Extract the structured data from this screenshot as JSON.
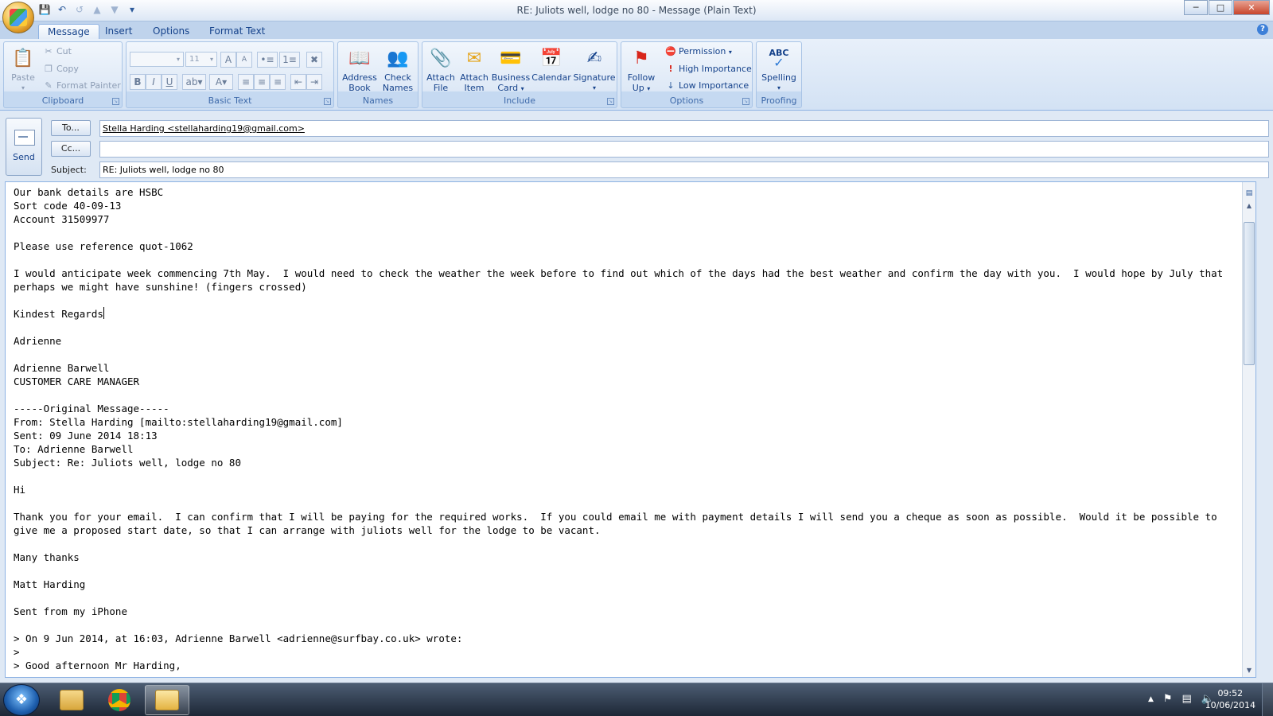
{
  "window": {
    "title": "RE: Juliots well, lodge no 80 - Message (Plain Text)"
  },
  "qat": {
    "save_icon": "save-icon",
    "undo_icon": "undo-icon",
    "redo_icon": "redo-icon"
  },
  "tabs": [
    {
      "label": "Message",
      "active": true
    },
    {
      "label": "Insert"
    },
    {
      "label": "Options"
    },
    {
      "label": "Format Text"
    }
  ],
  "ribbon": {
    "clipboard": {
      "label": "Clipboard",
      "paste": "Paste",
      "cut": "Cut",
      "copy": "Copy",
      "format_painter": "Format Painter"
    },
    "basic_text": {
      "label": "Basic Text",
      "font_size": "11",
      "bold": "B",
      "italic": "I",
      "underline": "U"
    },
    "names": {
      "label": "Names",
      "address_book_1": "Address",
      "address_book_2": "Book",
      "check_names_1": "Check",
      "check_names_2": "Names"
    },
    "include": {
      "label": "Include",
      "attach_file_1": "Attach",
      "attach_file_2": "File",
      "attach_item_1": "Attach",
      "attach_item_2": "Item",
      "business_card_1": "Business",
      "business_card_2": "Card",
      "calendar": "Calendar",
      "signature": "Signature"
    },
    "options": {
      "label": "Options",
      "follow_up_1": "Follow",
      "follow_up_2": "Up",
      "permission": "Permission",
      "high_importance": "High Importance",
      "low_importance": "Low Importance"
    },
    "proofing": {
      "label": "Proofing",
      "spelling": "Spelling",
      "abc": "ABC"
    }
  },
  "header": {
    "send_label": "Send",
    "to_label": "To...",
    "cc_label": "Cc...",
    "subject_label": "Subject:",
    "to_value": "Stella Harding <stellaharding19@gmail.com>",
    "cc_value": "",
    "subject_value": "RE: Juliots well, lodge no 80"
  },
  "body": {
    "before_caret": "Our bank details are HSBC\nSort code 40-09-13\nAccount 31509977\n\nPlease use reference quot-1062\n\nI would anticipate week commencing 7th May.  I would need to check the weather the week before to find out which of the days had the best weather and confirm the day with you.  I would hope by July that perhaps we might have sunshine! (fingers crossed)\n\nKindest Regards",
    "after_caret": "\n\nAdrienne\n\nAdrienne Barwell\nCUSTOMER CARE MANAGER\n\n-----Original Message-----\nFrom: Stella Harding [mailto:stellaharding19@gmail.com]\nSent: 09 June 2014 18:13\nTo: Adrienne Barwell\nSubject: Re: Juliots well, lodge no 80\n\nHi\n\nThank you for your email.  I can confirm that I will be paying for the required works.  If you could email me with payment details I will send you a cheque as soon as possible.  Would it be possible to give me a proposed start date, so that I can arrange with juliots well for the lodge to be vacant.\n\nMany thanks\n\nMatt Harding\n\nSent from my iPhone\n\n> On 9 Jun 2014, at 16:03, Adrienne Barwell <adrienne@surfbay.co.uk> wrote:\n>\n> Good afternoon Mr Harding,\n>"
  },
  "taskbar": {
    "time": "09:52",
    "date": "10/06/2014"
  }
}
